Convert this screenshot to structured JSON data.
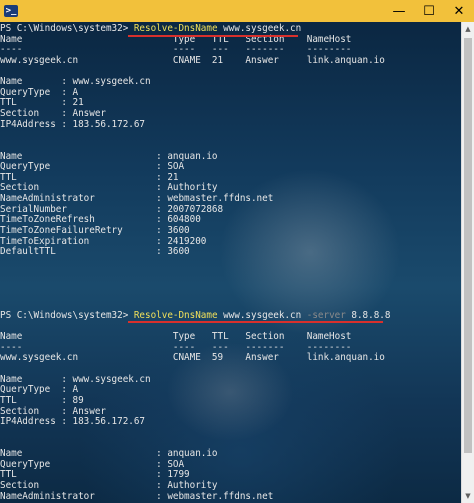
{
  "window": {
    "title": "",
    "minimize_icon": "minimize-icon",
    "maximize_icon": "maximize-icon",
    "close_icon": "close-icon",
    "titlebar_color": "#f2c13b"
  },
  "console": {
    "lines": [
      {
        "segments": [
          {
            "text": "PS C:\\Windows\\system32> ",
            "style": "plain"
          },
          {
            "text": "Resolve-DnsName",
            "style": "hl"
          },
          {
            "text": " www.sysgeek.cn",
            "style": "plain"
          }
        ]
      },
      {
        "segments": [
          {
            "text": "Name                           Type   TTL   Section    NameHost",
            "style": "plain"
          }
        ]
      },
      {
        "segments": [
          {
            "text": "----                           ----   ---   -------    --------",
            "style": "plain"
          }
        ]
      },
      {
        "segments": [
          {
            "text": "www.sysgeek.cn                 CNAME  21    Answer     link.anquan.io",
            "style": "plain"
          }
        ]
      },
      {
        "segments": [
          {
            "text": "",
            "style": "plain"
          }
        ]
      },
      {
        "segments": [
          {
            "text": "Name       : www.sysgeek.cn",
            "style": "plain"
          }
        ]
      },
      {
        "segments": [
          {
            "text": "QueryType  : A",
            "style": "plain"
          }
        ]
      },
      {
        "segments": [
          {
            "text": "TTL        : 21",
            "style": "plain"
          }
        ]
      },
      {
        "segments": [
          {
            "text": "Section    : Answer",
            "style": "plain"
          }
        ]
      },
      {
        "segments": [
          {
            "text": "IP4Address : 183.56.172.67",
            "style": "plain"
          }
        ]
      },
      {
        "segments": [
          {
            "text": "",
            "style": "plain"
          }
        ]
      },
      {
        "segments": [
          {
            "text": "",
            "style": "plain"
          }
        ]
      },
      {
        "segments": [
          {
            "text": "Name                        : anquan.io",
            "style": "plain"
          }
        ]
      },
      {
        "segments": [
          {
            "text": "QueryType                   : SOA",
            "style": "plain"
          }
        ]
      },
      {
        "segments": [
          {
            "text": "TTL                         : 21",
            "style": "plain"
          }
        ]
      },
      {
        "segments": [
          {
            "text": "Section                     : Authority",
            "style": "plain"
          }
        ]
      },
      {
        "segments": [
          {
            "text": "NameAdministrator           : webmaster.ffdns.net",
            "style": "plain"
          }
        ]
      },
      {
        "segments": [
          {
            "text": "SerialNumber                : 2007072868",
            "style": "plain"
          }
        ]
      },
      {
        "segments": [
          {
            "text": "TimeToZoneRefresh           : 604800",
            "style": "plain"
          }
        ]
      },
      {
        "segments": [
          {
            "text": "TimeToZoneFailureRetry      : 3600",
            "style": "plain"
          }
        ]
      },
      {
        "segments": [
          {
            "text": "TimeToExpiration            : 2419200",
            "style": "plain"
          }
        ]
      },
      {
        "segments": [
          {
            "text": "DefaultTTL                  : 3600",
            "style": "plain"
          }
        ]
      },
      {
        "segments": [
          {
            "text": "",
            "style": "plain"
          }
        ]
      },
      {
        "segments": [
          {
            "text": "",
            "style": "plain"
          }
        ]
      },
      {
        "segments": [
          {
            "text": "",
            "style": "plain"
          }
        ]
      },
      {
        "segments": [
          {
            "text": "",
            "style": "plain"
          }
        ]
      },
      {
        "segments": [
          {
            "text": "",
            "style": "plain"
          }
        ]
      },
      {
        "segments": [
          {
            "text": "PS C:\\Windows\\system32> ",
            "style": "plain"
          },
          {
            "text": "Resolve-DnsName",
            "style": "hl"
          },
          {
            "text": " www.sysgeek.cn ",
            "style": "plain"
          },
          {
            "text": "-server",
            "style": "param"
          },
          {
            "text": " 8.8.8.8",
            "style": "plain"
          }
        ]
      },
      {
        "segments": [
          {
            "text": "",
            "style": "plain"
          }
        ]
      },
      {
        "segments": [
          {
            "text": "Name                           Type   TTL   Section    NameHost",
            "style": "plain"
          }
        ]
      },
      {
        "segments": [
          {
            "text": "----                           ----   ---   -------    --------",
            "style": "plain"
          }
        ]
      },
      {
        "segments": [
          {
            "text": "www.sysgeek.cn                 CNAME  59    Answer     link.anquan.io",
            "style": "plain"
          }
        ]
      },
      {
        "segments": [
          {
            "text": "",
            "style": "plain"
          }
        ]
      },
      {
        "segments": [
          {
            "text": "Name       : www.sysgeek.cn",
            "style": "plain"
          }
        ]
      },
      {
        "segments": [
          {
            "text": "QueryType  : A",
            "style": "plain"
          }
        ]
      },
      {
        "segments": [
          {
            "text": "TTL        : 89",
            "style": "plain"
          }
        ]
      },
      {
        "segments": [
          {
            "text": "Section    : Answer",
            "style": "plain"
          }
        ]
      },
      {
        "segments": [
          {
            "text": "IP4Address : 183.56.172.67",
            "style": "plain"
          }
        ]
      },
      {
        "segments": [
          {
            "text": "",
            "style": "plain"
          }
        ]
      },
      {
        "segments": [
          {
            "text": "",
            "style": "plain"
          }
        ]
      },
      {
        "segments": [
          {
            "text": "Name                        : anquan.io",
            "style": "plain"
          }
        ]
      },
      {
        "segments": [
          {
            "text": "QueryType                   : SOA",
            "style": "plain"
          }
        ]
      },
      {
        "segments": [
          {
            "text": "TTL                         : 1799",
            "style": "plain"
          }
        ]
      },
      {
        "segments": [
          {
            "text": "Section                     : Authority",
            "style": "plain"
          }
        ]
      },
      {
        "segments": [
          {
            "text": "NameAdministrator           : webmaster.ffdns.net",
            "style": "plain"
          }
        ]
      }
    ],
    "colors": {
      "text": "#e6e6e6",
      "command_highlight": "#f0e05a",
      "parameter": "#8a8a8a",
      "annotation_underline": "#d8302c"
    }
  },
  "scrollbar": {
    "up_icon": "scroll-up-arrow-icon",
    "down_icon": "scroll-down-arrow-icon"
  }
}
